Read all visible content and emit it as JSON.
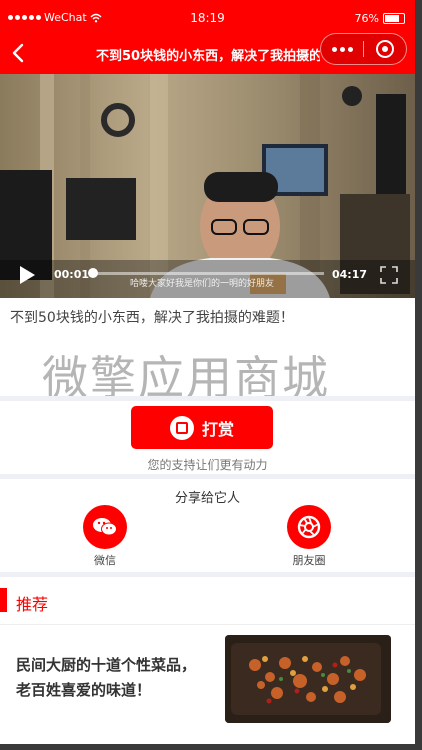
{
  "status_bar": {
    "carrier": "WeChat",
    "time": "18:19",
    "battery": "76%"
  },
  "nav": {
    "title": "不到50块钱的小东西，解决了我拍摄的难题！",
    "back_icon": "chevron-left-icon",
    "more_icon": "more-dots-icon",
    "close_icon": "target-close-icon"
  },
  "video": {
    "current_time": "00:01",
    "duration": "04:17",
    "progress": 0.004,
    "subtitle": "哈喽大家好我是你们的一明的好朋友"
  },
  "content": {
    "title": "不到50块钱的小东西，解决了我拍摄的难题！",
    "watermark": "微擎应用商城"
  },
  "reward": {
    "button_label": "打赏",
    "note": "您的支持让们更有动力"
  },
  "share": {
    "heading": "分享给它人",
    "items": [
      {
        "label": "微信",
        "icon": "wechat-icon"
      },
      {
        "label": "朋友圈",
        "icon": "moments-icon"
      }
    ]
  },
  "recommend": {
    "heading": "推荐",
    "articles": [
      {
        "title": "民间大厨的十道个性菜品，老百姓喜爱的味道！"
      }
    ]
  },
  "colors": {
    "brand_red": "#ff0000",
    "separator": "#eef0f6"
  }
}
